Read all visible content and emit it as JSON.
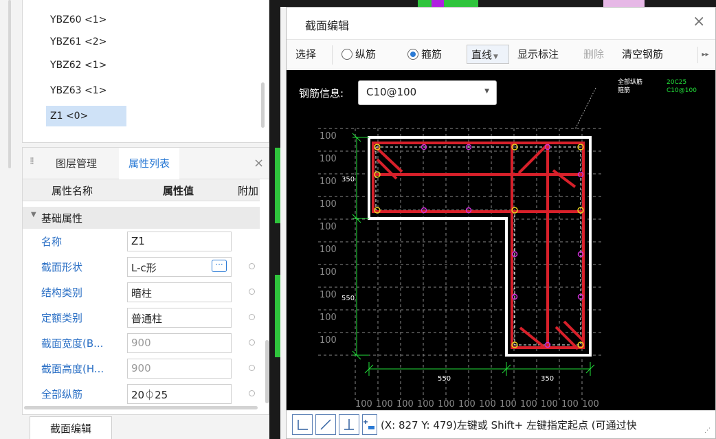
{
  "component_list": {
    "items": [
      {
        "label": "YBZ60  <1>"
      },
      {
        "label": "YBZ61  <2>"
      },
      {
        "label": "YBZ62  <1>"
      },
      {
        "label": "YBZ63  <1>"
      },
      {
        "label": "Z1  <0>",
        "selected": true
      }
    ]
  },
  "property_panel": {
    "tabs": [
      {
        "label": "图层管理"
      },
      {
        "label": "属性列表",
        "active": true
      }
    ],
    "close_icon": "close-icon",
    "columns": {
      "name": "属性名称",
      "value": "属性值",
      "extra": "附加"
    },
    "group": "基础属性",
    "rows": [
      {
        "name": "名称",
        "value": "Z1"
      },
      {
        "name": "截面形状",
        "value": "L-c形",
        "has_more": true
      },
      {
        "name": "结构类别",
        "value": "暗柱"
      },
      {
        "name": "定额类别",
        "value": "普通柱"
      },
      {
        "name": "截面宽度(B...",
        "value": "900",
        "gray": true
      },
      {
        "name": "截面高度(H...",
        "value": "900",
        "gray": true
      },
      {
        "name": "全部纵筋",
        "value": "20⏀25"
      }
    ]
  },
  "section_edit_button": "截面编辑",
  "dialog": {
    "title": "截面编辑",
    "toolbar": {
      "select": "选择",
      "longitudinal": "纵筋",
      "stirrup": "箍筋",
      "line_mode": "直线",
      "show_labels": "显示标注",
      "delete": "删除",
      "clear_rebar": "清空钢筋"
    },
    "rebar_info_label": "钢筋信息:",
    "rebar_info_value": "C10@100",
    "canvas": {
      "legend": [
        {
          "label": "全部纵筋",
          "value": "20C25"
        },
        {
          "label": "箍筋",
          "value": "C10@100"
        }
      ],
      "left_grid_labels": [
        "100",
        "100",
        "100",
        "100",
        "100",
        "100",
        "100",
        "100",
        "100",
        "100"
      ],
      "bottom_grid_labels": [
        "100",
        "100",
        "100",
        "100",
        "100",
        "100",
        "100",
        "100",
        "100",
        "100",
        "100",
        "100"
      ],
      "dimension_labels": {
        "left_top": "350",
        "left_bottom": "550",
        "bottom_left": "550",
        "bottom_right": "350"
      }
    },
    "status": "(X: 827 Y: 479)左键或 Shift+ 左键指定起点 (可通过快"
  },
  "colors": {
    "accent": "#2a7ad5",
    "rebar_red": "#d8202a",
    "outline_white": "#ffffff",
    "dimension_green": "#22e03a",
    "grid_gray": "#8a8a8a",
    "point_magenta": "#d030d8",
    "point_yellow": "#e8d020"
  }
}
